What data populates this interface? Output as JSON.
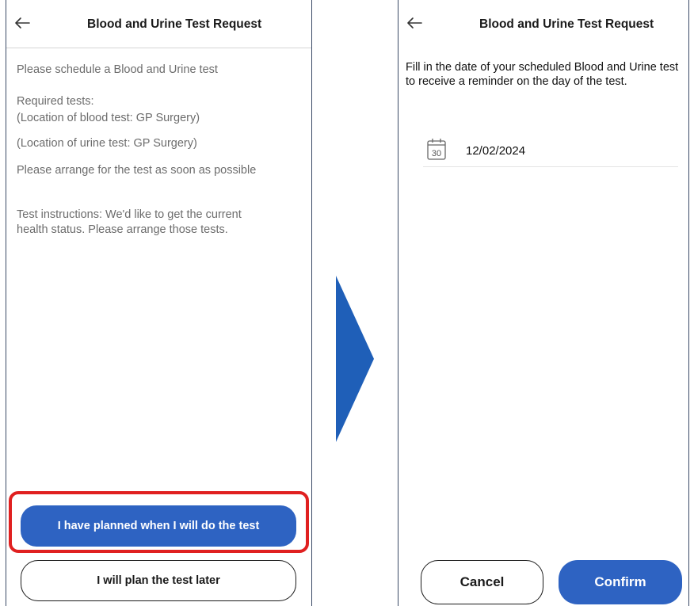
{
  "left_screen": {
    "header": {
      "title": "Blood and Urine Test Request"
    },
    "intro": "Please schedule a Blood and Urine test",
    "required_tests": "Required tests:\n(Location of blood test: GP Surgery)",
    "urine_location": "(Location of urine test: GP Surgery)",
    "arrange_note": "Please arrange for the test as soon as possible",
    "instructions": "Test instructions: We'd like to get the current\nhealth status. Please arrange those tests.",
    "buttons": {
      "planned": "I have planned when I will do the test",
      "later": "I will plan the test later"
    }
  },
  "right_screen": {
    "header": {
      "title": "Blood and Urine Test Request"
    },
    "instructions": "Fill in the date of your scheduled Blood and Urine test to receive a reminder on the day of the test.",
    "date_field": {
      "value": "12/02/2024",
      "calendar_day": "30"
    },
    "buttons": {
      "cancel": "Cancel",
      "confirm": "Confirm"
    }
  },
  "icons": {
    "back": "arrow-left-icon",
    "calendar": "calendar-icon",
    "transition": "chevron-right-arrow"
  },
  "colors": {
    "primary": "#2e63c2",
    "highlight": "#e02020",
    "transition_arrow": "#1f5fb8"
  }
}
